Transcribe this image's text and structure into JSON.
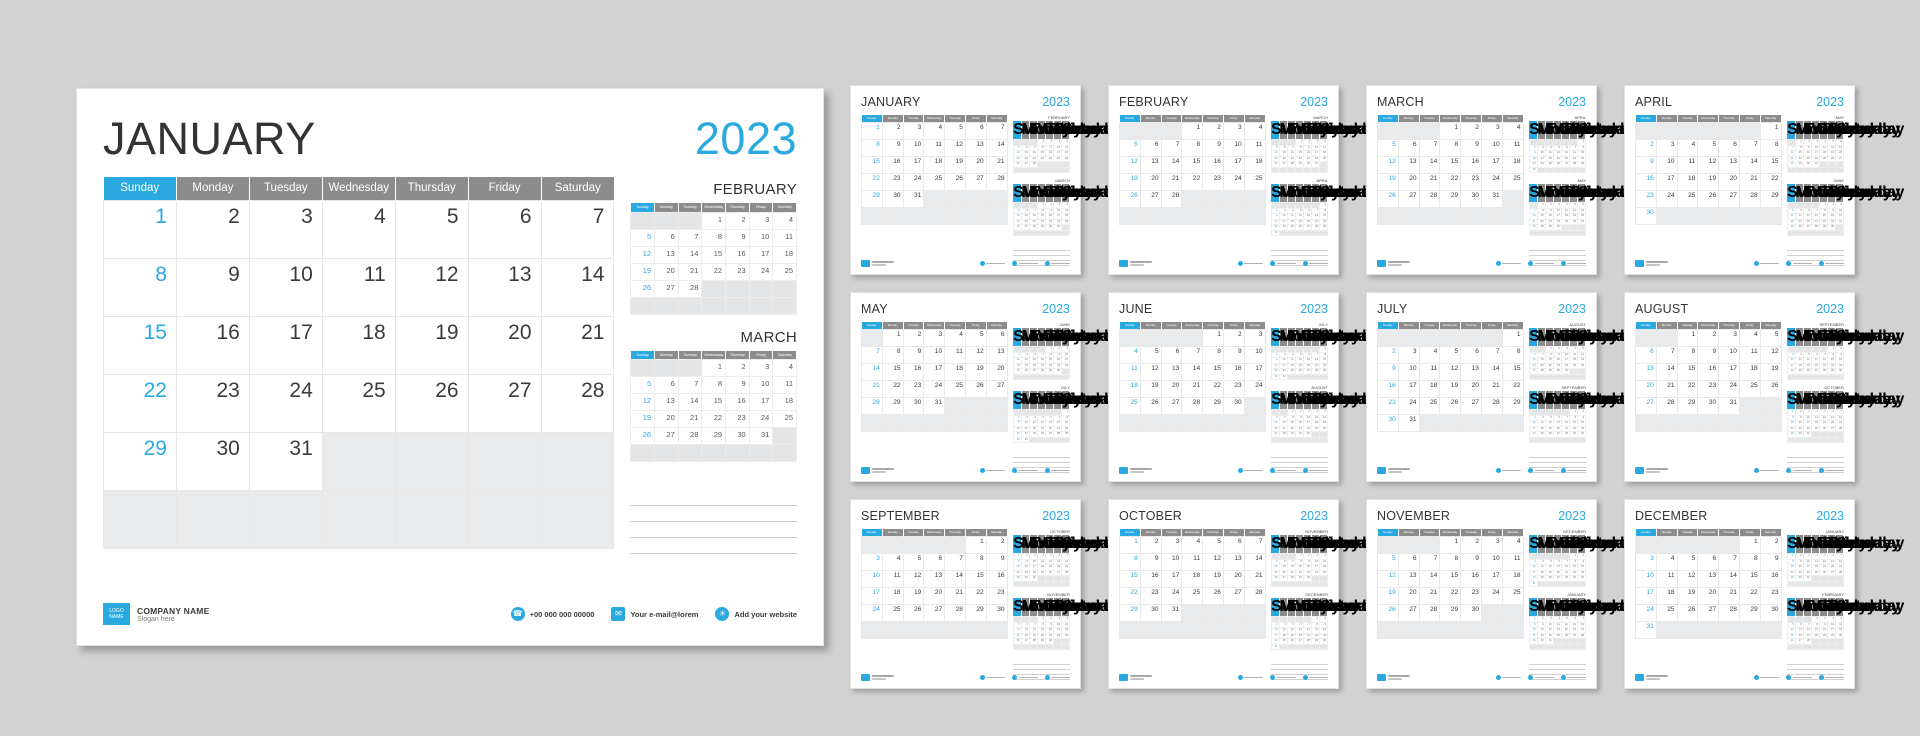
{
  "theme": {
    "accent": "#29a9e0",
    "header_gray": "#8c8c8c",
    "off_day_bg": "#e9eaec",
    "page_bg": "#d2d2d2"
  },
  "year": "2023",
  "weekday_headers": [
    "Sunday",
    "Monday",
    "Tuesday",
    "Wednesday",
    "Thursday",
    "Friday",
    "Saturday"
  ],
  "featured": {
    "month": "JANUARY",
    "year": "2023",
    "side_months": [
      "FEBRUARY",
      "MARCH"
    ],
    "note_line_count": 4
  },
  "footer": {
    "logo_line1": "LOGO",
    "logo_line2": "NAME",
    "company_name": "COMPANY NAME",
    "slogan": "Slogan here",
    "phone_icon": "phone-icon",
    "phone": "+00 000 000 00000",
    "email_icon": "envelope-icon",
    "email": "Your e-mail@lorem",
    "website_icon": "globe-icon",
    "website": "Add your website"
  },
  "months": [
    {
      "name": "JANUARY",
      "year": "2023",
      "start": 0,
      "days": 31,
      "next": [
        "FEBRUARY",
        "MARCH"
      ]
    },
    {
      "name": "FEBRUARY",
      "year": "2023",
      "start": 3,
      "days": 28,
      "next": [
        "MARCH",
        "APRIL"
      ]
    },
    {
      "name": "MARCH",
      "year": "2023",
      "start": 3,
      "days": 31,
      "next": [
        "APRIL",
        "MAY"
      ]
    },
    {
      "name": "APRIL",
      "year": "2023",
      "start": 6,
      "days": 30,
      "next": [
        "MAY",
        "JUNE"
      ]
    },
    {
      "name": "MAY",
      "year": "2023",
      "start": 1,
      "days": 31,
      "next": [
        "JUNE",
        "JULY"
      ]
    },
    {
      "name": "JUNE",
      "year": "2023",
      "start": 4,
      "days": 30,
      "next": [
        "JULY",
        "AUGUST"
      ]
    },
    {
      "name": "JULY",
      "year": "2023",
      "start": 6,
      "days": 31,
      "next": [
        "AUGUST",
        "SEPTEMBER"
      ]
    },
    {
      "name": "AUGUST",
      "year": "2023",
      "start": 2,
      "days": 31,
      "next": [
        "SEPTEMBER",
        "OCTOBER"
      ]
    },
    {
      "name": "SEPTEMBER",
      "year": "2023",
      "start": 5,
      "days": 30,
      "next": [
        "OCTOBER",
        "NOVEMBER"
      ]
    },
    {
      "name": "OCTOBER",
      "year": "2023",
      "start": 0,
      "days": 31,
      "next": [
        "NOVEMBER",
        "DECEMBER"
      ]
    },
    {
      "name": "NOVEMBER",
      "year": "2023",
      "start": 3,
      "days": 30,
      "next": [
        "DECEMBER",
        "JANUARY"
      ]
    },
    {
      "name": "DECEMBER",
      "year": "2023",
      "start": 5,
      "days": 31,
      "next": [
        "JANUARY",
        "FEBRUARY"
      ]
    }
  ],
  "mini_month_starts": {
    "JANUARY": 0,
    "FEBRUARY": 3,
    "MARCH": 3,
    "APRIL": 6,
    "MAY": 1,
    "JUNE": 4,
    "JULY": 6,
    "AUGUST": 2,
    "SEPTEMBER": 5,
    "OCTOBER": 0,
    "NOVEMBER": 3,
    "DECEMBER": 5
  },
  "mini_month_days": {
    "JANUARY": 31,
    "FEBRUARY": 28,
    "MARCH": 31,
    "APRIL": 30,
    "MAY": 31,
    "JUNE": 30,
    "JULY": 31,
    "AUGUST": 31,
    "SEPTEMBER": 30,
    "OCTOBER": 31,
    "NOVEMBER": 30,
    "DECEMBER": 31
  }
}
